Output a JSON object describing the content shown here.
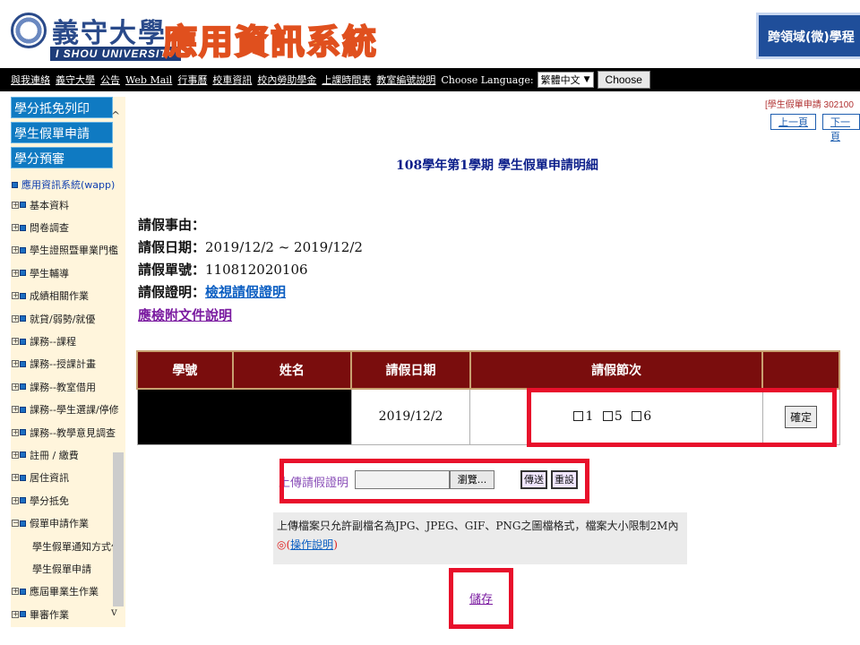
{
  "header": {
    "university_zh": "義守大學",
    "university_en": "I SHOU UNIVERSITY",
    "system_title": "應用資訊系統",
    "cross_domain_button": "跨領域(微)學程"
  },
  "navbar": {
    "links": [
      "與我連絡",
      "義守大學",
      "公告",
      "Web Mail",
      "行事曆",
      "校車資訊",
      "校內勞助學金",
      "上課時間表",
      "教室編號說明"
    ],
    "language_label": "Choose Language:",
    "language_value": "繁體中文",
    "choose_button": "Choose"
  },
  "sidebar": {
    "tabs": [
      "學分抵免列印",
      "學生假單申請",
      "學分預審"
    ],
    "root": "應用資訊系統(wapp)",
    "items_before": [
      "基本資料",
      "問卷調查",
      "學生證照暨畢業門檻",
      "學生輔導",
      "成績相關作業",
      "就貸/弱勢/就優",
      "課務--課程",
      "課務--授課計畫",
      "課務--教室借用",
      "課務--學生選課/停修",
      "課務--教學意見調查",
      "註冊 / 繳費",
      "居住資訊",
      "學分抵免",
      "假單申請作業"
    ],
    "sub_items": [
      "學生假單通知方式作",
      "學生假單申請"
    ],
    "items_after": [
      "應屆畢業生作業",
      "畢審作業"
    ],
    "scroll_up": "^",
    "scroll_down": "v"
  },
  "main": {
    "top_right_note": "[學生假單申請 302100",
    "prev_button": "上一頁",
    "next_button": "下一頁",
    "heading": "108學年第1學期 學生假單申請明細",
    "reason_label": "請假事由：",
    "reason_value": "",
    "date_label": "請假日期：",
    "date_value": "2019/12/2 ~  2019/12/2",
    "leave_no_label": "請假單號：",
    "leave_no_value": "110812020106",
    "proof_label": "請假證明：",
    "proof_link": "檢視請假證明",
    "doc_link": "應檢附文件說明"
  },
  "table": {
    "headers": [
      "學號",
      "姓名",
      "請假日期",
      "請假節次",
      ""
    ],
    "row": {
      "date": "2019/12/2",
      "periods": [
        "1",
        "5",
        "6"
      ],
      "confirm_button": "確定"
    }
  },
  "upload": {
    "label": "上傳請假證明",
    "browse_button": "瀏覽...",
    "send_button": "傳送",
    "reset_button": "重設"
  },
  "note": {
    "line1": "上傳檔案只允許副檔名為JPG、JPEG、GIF、PNG之圖檔格式，檔案大小限制2M內",
    "circle": "◎",
    "paren_open": "(",
    "instructions_link": "操作說明",
    "paren_close": ")"
  },
  "save_link": "儲存",
  "colors": {
    "table_header": "#7a0d0d",
    "nav_bar": "#000000",
    "sidebar_tab": "#0f7ac2",
    "sidebar_bg": "#fff5dc",
    "highlight_outline": "#e8102b"
  }
}
